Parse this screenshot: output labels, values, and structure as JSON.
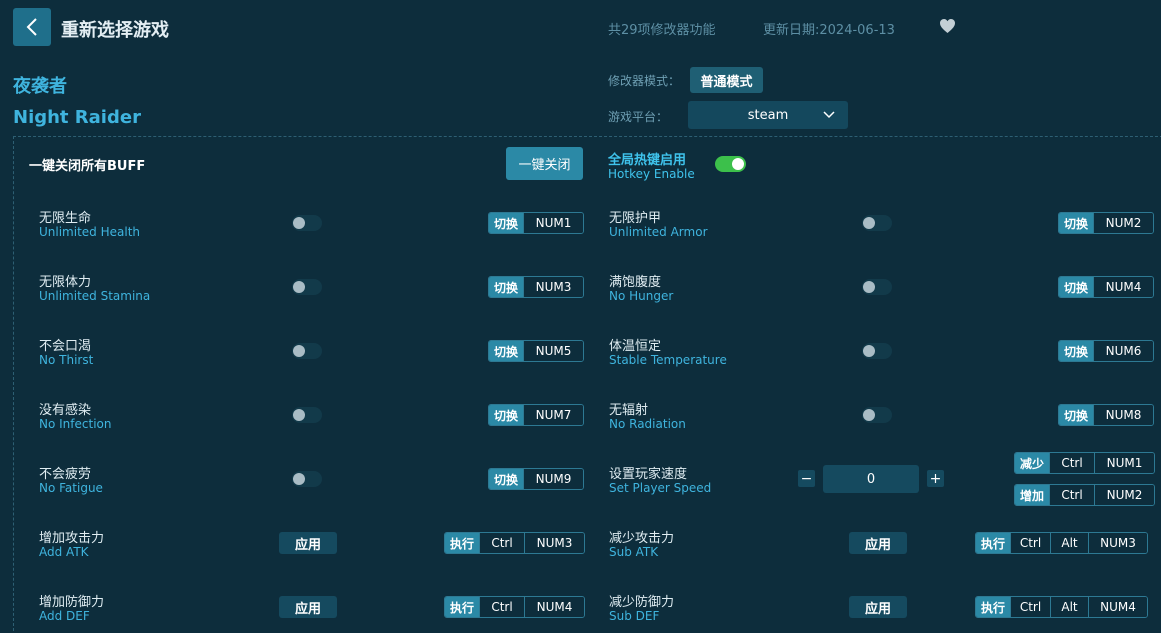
{
  "header": {
    "title": "重新选择游戏",
    "feature_count": "共29项修改器功能",
    "update_date": "更新日期:2024-06-13"
  },
  "game": {
    "name_cn": "夜袭者",
    "name_en": "Night Raider"
  },
  "mode": {
    "label": "修改器模式：",
    "value": "普通模式"
  },
  "platform": {
    "label": "游戏平台：",
    "value": "steam"
  },
  "panel": {
    "close_all_label": "一键关闭所有BUFF",
    "close_all_button": "一键关闭",
    "hotkey_cn": "全局热键启用",
    "hotkey_en": "Hotkey Enable",
    "hotkey_enabled": true
  },
  "options": [
    {
      "cn": "无限生命",
      "en": "Unlimited Health",
      "action": "切换",
      "keys": [
        "NUM1"
      ]
    },
    {
      "cn": "无限护甲",
      "en": "Unlimited Armor",
      "action": "切换",
      "keys": [
        "NUM2"
      ]
    },
    {
      "cn": "无限体力",
      "en": "Unlimited Stamina",
      "action": "切换",
      "keys": [
        "NUM3"
      ]
    },
    {
      "cn": "满饱腹度",
      "en": "No Hunger",
      "action": "切换",
      "keys": [
        "NUM4"
      ]
    },
    {
      "cn": "不会口渴",
      "en": "No Thirst",
      "action": "切换",
      "keys": [
        "NUM5"
      ]
    },
    {
      "cn": "体温恒定",
      "en": "Stable Temperature",
      "action": "切换",
      "keys": [
        "NUM6"
      ]
    },
    {
      "cn": "没有感染",
      "en": "No Infection",
      "action": "切换",
      "keys": [
        "NUM7"
      ]
    },
    {
      "cn": "无辐射",
      "en": "No Radiation",
      "action": "切换",
      "keys": [
        "NUM8"
      ]
    },
    {
      "cn": "不会疲劳",
      "en": "No Fatigue",
      "action": "切换",
      "keys": [
        "NUM9"
      ]
    }
  ],
  "speed": {
    "cn": "设置玩家速度",
    "en": "Set Player Speed",
    "minus": "−",
    "plus": "+",
    "value": "0",
    "decrease": {
      "action": "减少",
      "keys": [
        "Ctrl",
        "NUM1"
      ]
    },
    "increase": {
      "action": "增加",
      "keys": [
        "Ctrl",
        "NUM2"
      ]
    }
  },
  "apply_options": [
    {
      "cn": "增加攻击力",
      "en": "Add ATK",
      "button": "应用",
      "action": "执行",
      "keys": [
        "Ctrl",
        "NUM3"
      ]
    },
    {
      "cn": "减少攻击力",
      "en": "Sub ATK",
      "button": "应用",
      "action": "执行",
      "keys": [
        "Ctrl",
        "Alt",
        "NUM3"
      ]
    },
    {
      "cn": "增加防御力",
      "en": "Add DEF",
      "button": "应用",
      "action": "执行",
      "keys": [
        "Ctrl",
        "NUM4"
      ]
    },
    {
      "cn": "减少防御力",
      "en": "Sub DEF",
      "button": "应用",
      "action": "执行",
      "keys": [
        "Ctrl",
        "Alt",
        "NUM4"
      ]
    }
  ],
  "colors": {
    "background": "#0d2d3c",
    "accent": "#3fb4de",
    "button": "#2b89a6",
    "toggle_on": "#3cc04b"
  }
}
